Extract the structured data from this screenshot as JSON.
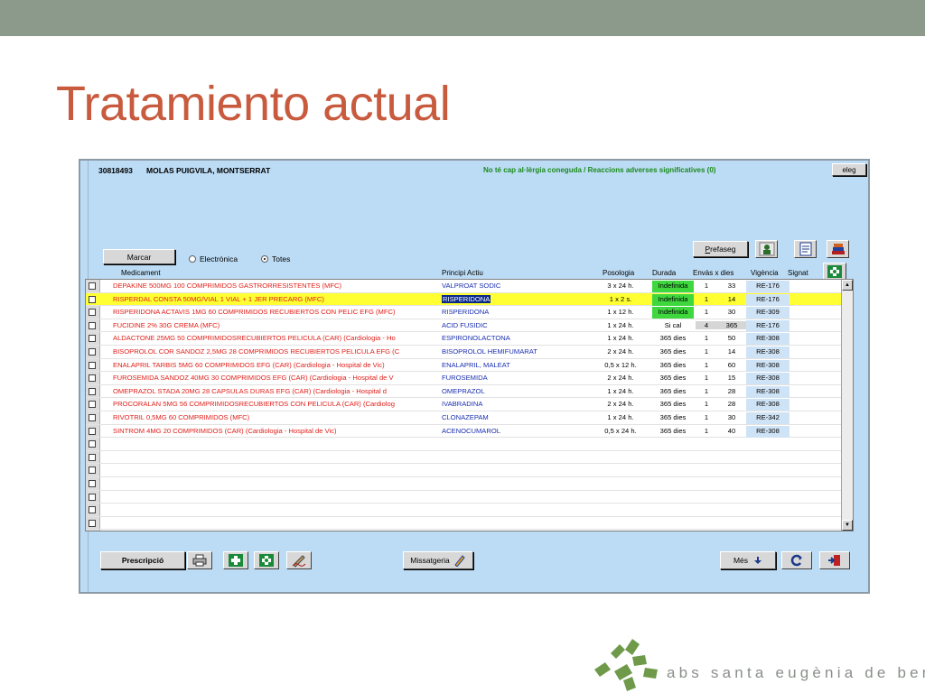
{
  "slide": {
    "title": "Tratamiento actual"
  },
  "patient": {
    "id": "30818493",
    "name": "MOLAS PUIGVILA, MONTSERRAT",
    "allergy_notice": "No té cap al·lèrgia coneguda / Reaccions adverses significatives (0)",
    "eleg_label": "eleg"
  },
  "controls": {
    "marcar_label": "Marcar",
    "radio_electronica": "Electrònica",
    "radio_totes": "Totes",
    "selected_filter": "Totes",
    "prefaseg_label": "Prefaseg",
    "prefaseg_underline": "P",
    "prefaseg_rest": "refaseg"
  },
  "columns": {
    "medicament": "Medicament",
    "principi_actiu": "Principi Actiu",
    "posologia": "Posologia",
    "durada": "Durada",
    "envas_x_dies": "Envàs x dies",
    "vigencia": "Vigència",
    "signat": "Signat"
  },
  "rows": [
    {
      "medicament": "DEPAKINE 500MG 100 COMPRIMIDOS GASTRORRESISTENTES  (MFC)",
      "principi": "VALPROAT SODIC",
      "posologia": "3 x 24 h.",
      "durada": "Indefinida",
      "envas": "1",
      "dies": "33",
      "vigencia": "RE-176"
    },
    {
      "medicament": "RISPERDAL CONSTA 50MG/VIAL 1 VIAL + 1 JER PRECARG  (MFC)",
      "principi": "RISPERIDONA",
      "posologia": "1 x 2 s.",
      "durada": "Indefinida",
      "envas": "1",
      "dies": "14",
      "vigencia": "RE-176"
    },
    {
      "medicament": "RISPERIDONA ACTAVIS 1MG 60 COMPRIMIDOS RECUBIERTOS CON PELIC EFG  (MFC)",
      "principi": "RISPERIDONA",
      "posologia": "1 x 12 h.",
      "durada": "Indefinida",
      "envas": "1",
      "dies": "30",
      "vigencia": "RE-309"
    },
    {
      "medicament": "FUCIDINE 2% 30G CREMA  (MFC)",
      "principi": "ACID FUSIDIC",
      "posologia": "1 x 24 h.",
      "durada": "Si cal",
      "envas": "4",
      "dies": "365",
      "vigencia": "RE-176"
    },
    {
      "medicament": "ALDACTONE 25MG 50 COMPRIMIDOSRECUBIERTOS PELICULA  (CAR) (Cardiologia - Ho",
      "principi": "ESPIRONOLACTONA",
      "posologia": "1 x 24 h.",
      "durada": "365 dies",
      "envas": "1",
      "dies": "50",
      "vigencia": "RE-308"
    },
    {
      "medicament": "BISOPROLOL COR SANDOZ 2,5MG 28 COMPRIMIDOS RECUBIERTOS PELICULA EFG  (C",
      "principi": "BISOPROLOL HEMIFUMARAT",
      "posologia": "2 x 24 h.",
      "durada": "365 dies",
      "envas": "1",
      "dies": "14",
      "vigencia": "RE-308"
    },
    {
      "medicament": "ENALAPRIL TARBIS 5MG 60 COMPRIMIDOS EFG  (CAR) (Cardiologia - Hospital de Vic)",
      "principi": "ENALAPRIL, MALEAT",
      "posologia": "0,5 x 12 h.",
      "durada": "365 dies",
      "envas": "1",
      "dies": "60",
      "vigencia": "RE-308"
    },
    {
      "medicament": "FUROSEMIDA SANDOZ 40MG 30 COMPRIMIDOS EFG  (CAR) (Cardiologia - Hospital de V",
      "principi": "FUROSEMIDA",
      "posologia": "2 x 24 h.",
      "durada": "365 dies",
      "envas": "1",
      "dies": "15",
      "vigencia": "RE-308"
    },
    {
      "medicament": "OMEPRAZOL STADA 20MG 28 CAPSULAS DURAS EFG  (CAR) (Cardiologia - Hospital d",
      "principi": "OMEPRAZOL",
      "posologia": "1 x 24 h.",
      "durada": "365 dies",
      "envas": "1",
      "dies": "28",
      "vigencia": "RE-308"
    },
    {
      "medicament": "PROCORALAN 5MG 56 COMPRIMIDOSRECUBIERTOS CON PELICULA  (CAR) (Cardiolog",
      "principi": "IVABRADINA",
      "posologia": "2 x 24 h.",
      "durada": "365 dies",
      "envas": "1",
      "dies": "28",
      "vigencia": "RE-308"
    },
    {
      "medicament": "RIVOTRIL 0,5MG 60 COMPRIMIDOS  (MFC)",
      "principi": "CLONAZEPAM",
      "posologia": "1 x 24 h.",
      "durada": "365 dies",
      "envas": "1",
      "dies": "30",
      "vigencia": "RE-342"
    },
    {
      "medicament": "SINTROM 4MG 20 COMPRIMIDOS  (CAR) (Cardiologia - Hospital de Vic)",
      "principi": "ACENOCUMAROL",
      "posologia": "0,5 x 24 h.",
      "durada": "365 dies",
      "envas": "1",
      "dies": "40",
      "vigencia": "RE-308"
    }
  ],
  "selected_row_index": 1,
  "empty_rows": 7,
  "footer": {
    "prescripcio_label": "Prescripció",
    "missatgeria_label": "Missatgeria",
    "mes_label": "Més"
  },
  "branding": {
    "logo_text": "abs santa eugènia de berga"
  },
  "colors": {
    "title": "#c85a3e",
    "medicament_text": "#e0201a",
    "principi_text": "#1a2fb0",
    "indefinida_bg": "#3ed83e",
    "selected_row_bg": "#ffff33",
    "app_bg": "#bcdcf5",
    "topbar": "#8b9a8b"
  }
}
